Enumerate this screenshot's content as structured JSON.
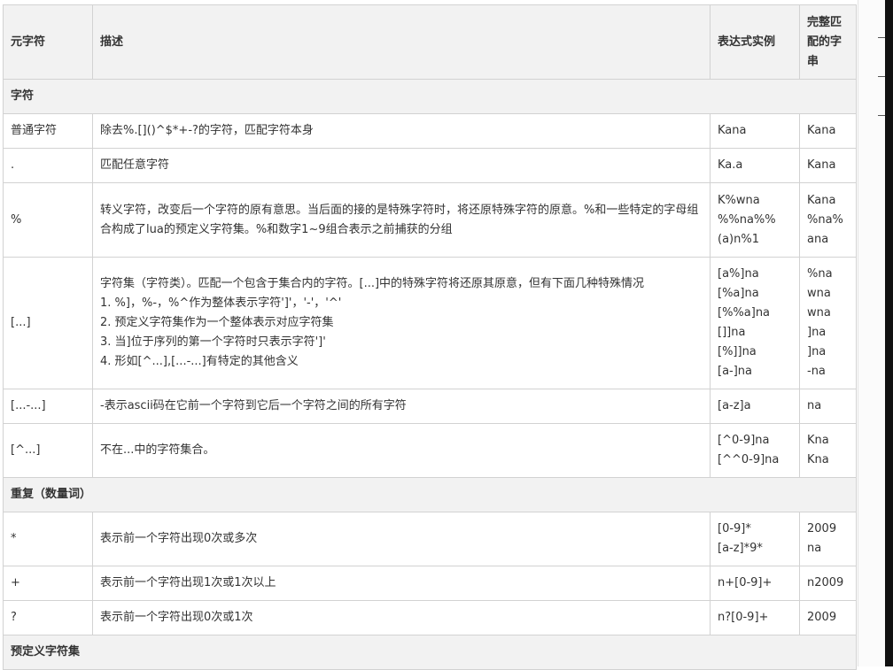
{
  "headers": [
    "元字符",
    "描述",
    "表达式实例",
    "完整匹配的字串"
  ],
  "sections": [
    {
      "title": "字符",
      "rows": [
        {
          "meta": "普通字符",
          "desc": [
            "除去%.[]()^$*+-?的字符，匹配字符本身"
          ],
          "example": [
            "Kana"
          ],
          "match": [
            "Kana"
          ]
        },
        {
          "meta": ".",
          "desc": [
            "匹配任意字符"
          ],
          "example": [
            "Ka.a"
          ],
          "match": [
            "Kana"
          ]
        },
        {
          "meta": "%",
          "desc": [
            "转义字符，改变后一个字符的原有意思。当后面的接的是特殊字符时，将还原特殊字符的原意。%和一些特定的字母组合构成了lua的预定义字符集。%和数字1~9组合表示之前捕获的分组"
          ],
          "example": [
            "K%wna",
            "%%na%%",
            "(a)n%1"
          ],
          "match": [
            "Kana",
            "%na%",
            "ana"
          ]
        },
        {
          "meta": "[...]",
          "desc": [
            "字符集（字符类）。匹配一个包含于集合内的字符。[...]中的特殊字符将还原其原意，但有下面几种特殊情况",
            "1. %]，%-，%^作为整体表示字符']'，'-'，'^'",
            "2. 预定义字符集作为一个整体表示对应字符集",
            "3. 当]位于序列的第一个字符时只表示字符']'",
            "4. 形如[^...],[...-...]有特定的其他含义"
          ],
          "example": [
            "[a%]na",
            "[%a]na",
            "[%%a]na",
            "[]]na",
            "[%]]na",
            "[a-]na"
          ],
          "match": [
            "%na",
            "wna",
            "wna",
            "]na",
            "]na",
            "-na"
          ]
        },
        {
          "meta": "[...-...]",
          "desc": [
            "-表示ascii码在它前一个字符到它后一个字符之间的所有字符"
          ],
          "example": [
            "[a-z]a"
          ],
          "match": [
            "na"
          ]
        },
        {
          "meta": "[^...]",
          "desc": [
            "不在...中的字符集合。"
          ],
          "example": [
            "[^0-9]na",
            "[^^0-9]na"
          ],
          "match": [
            "Kna",
            "Kna"
          ]
        }
      ]
    },
    {
      "title": "重复（数量词）",
      "rows": [
        {
          "meta": "*",
          "desc": [
            "表示前一个字符出现0次或多次"
          ],
          "example": [
            "[0-9]*",
            "[a-z]*9*"
          ],
          "match": [
            "2009",
            "na"
          ]
        },
        {
          "meta": "+",
          "desc": [
            "表示前一个字符出现1次或1次以上"
          ],
          "example": [
            "n+[0-9]+"
          ],
          "match": [
            "n2009"
          ]
        },
        {
          "meta": "?",
          "desc": [
            "表示前一个字符出现0次或1次"
          ],
          "example": [
            "n?[0-9]+"
          ],
          "match": [
            "2009"
          ]
        }
      ]
    },
    {
      "title": "预定义字符集",
      "rows": []
    }
  ]
}
